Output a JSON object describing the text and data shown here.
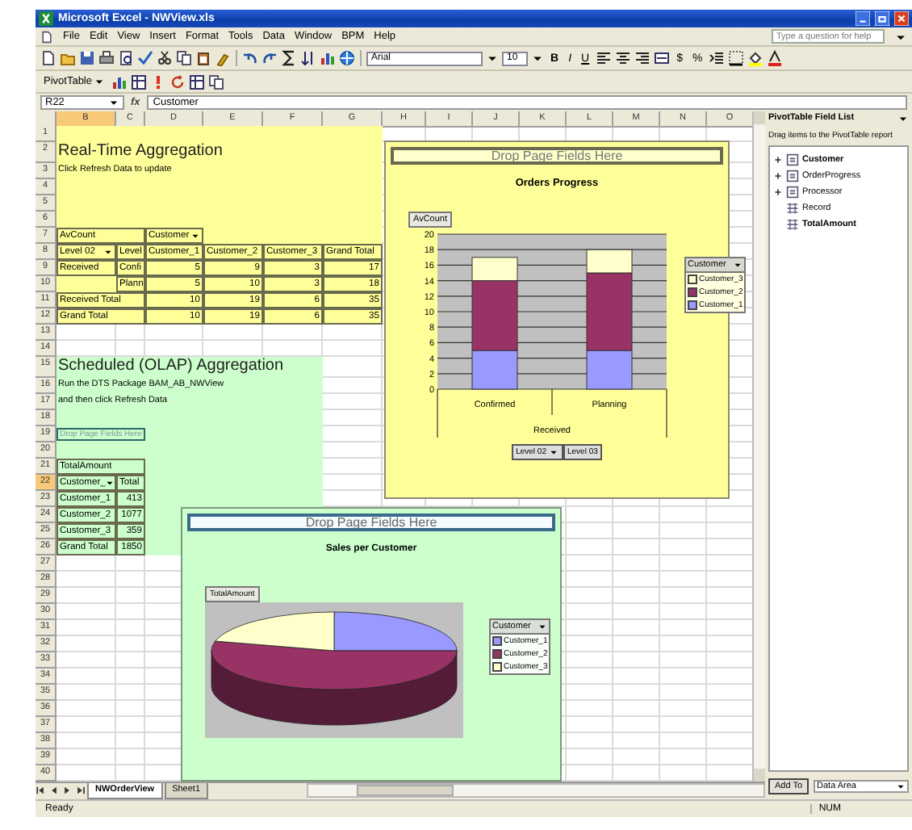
{
  "window": {
    "title": "Microsoft Excel - NWView.xls"
  },
  "menu_bar": {
    "items": [
      "File",
      "Edit",
      "View",
      "Insert",
      "Format",
      "Tools",
      "Data",
      "Window",
      "BPM",
      "Help"
    ],
    "help_box": {
      "placeholder": "Type a question for help"
    }
  },
  "formatting": {
    "font": "Arial",
    "size": "10",
    "styles": [
      "B",
      "I",
      "U"
    ],
    "number_formats": [
      "$",
      "%"
    ]
  },
  "pivot_toolbar": {
    "menu": "PivotTable"
  },
  "formula_bar": {
    "name_box": "R22",
    "function_label": "fx",
    "content": "Customer"
  },
  "sheet": {
    "columns": [
      {
        "label": "B",
        "selected": true
      },
      {
        "label": "C",
        "selected": false
      },
      {
        "label": "D",
        "selected": false
      },
      {
        "label": "E",
        "selected": false
      },
      {
        "label": "F",
        "selected": false
      },
      {
        "label": "G",
        "selected": false
      },
      {
        "label": "H",
        "selected": false
      },
      {
        "label": "I",
        "selected": false
      },
      {
        "label": "J",
        "selected": false
      },
      {
        "label": "K",
        "selected": false
      },
      {
        "label": "L",
        "selected": false
      },
      {
        "label": "M",
        "selected": false
      },
      {
        "label": "N",
        "selected": false
      },
      {
        "label": "O",
        "selected": false
      }
    ],
    "blocks": [
      {
        "kind": "realtime",
        "color": "#ffff99",
        "rows": [
          {
            "number": "1",
            "selected": false,
            "cells": {}
          },
          {
            "number": "2",
            "selected": false,
            "cells": {
              "B": {
                "kind": "title",
                "text": "Real-Time Aggregation"
              }
            }
          },
          {
            "number": "3",
            "selected": false,
            "cells": {
              "B": {
                "kind": "note",
                "text": "Click Refresh Data to update"
              }
            }
          },
          {
            "number": "4",
            "selected": false,
            "cells": {}
          },
          {
            "number": "5",
            "selected": false,
            "cells": {}
          },
          {
            "number": "6",
            "selected": false,
            "cells": {}
          },
          {
            "number": "7",
            "selected": false,
            "cells": {
              "B": {
                "kind": "field",
                "text": "AvCount"
              },
              "D": {
                "kind": "dropdown",
                "text": "Customer"
              }
            }
          },
          {
            "number": "8",
            "selected": false,
            "cells": {
              "B": {
                "kind": "dropdown",
                "text": "Level 02"
              },
              "C": {
                "kind": "field",
                "text": "Level"
              },
              "D": {
                "kind": "field",
                "text": "Customer_1"
              },
              "E": {
                "kind": "field",
                "text": "Customer_2"
              },
              "F": {
                "kind": "field",
                "text": "Customer_3"
              },
              "G": {
                "kind": "field",
                "text": "Grand Total"
              }
            }
          },
          {
            "number": "9",
            "selected": false,
            "cells": {
              "B": {
                "kind": "field",
                "text": "Received"
              },
              "C": {
                "kind": "field",
                "text": "Confi"
              },
              "D": {
                "kind": "number",
                "text": "5"
              },
              "E": {
                "kind": "number",
                "text": "9"
              },
              "F": {
                "kind": "number",
                "text": "3"
              },
              "G": {
                "kind": "number",
                "text": "17"
              }
            }
          },
          {
            "number": "10",
            "selected": false,
            "cells": {
              "C": {
                "kind": "field",
                "text": "Plann"
              },
              "D": {
                "kind": "number",
                "text": "5"
              },
              "E": {
                "kind": "number",
                "text": "10"
              },
              "F": {
                "kind": "number",
                "text": "3"
              },
              "G": {
                "kind": "number",
                "text": "18"
              }
            }
          },
          {
            "number": "11",
            "selected": false,
            "cells": {
              "B": {
                "kind": "field",
                "text": "Received Total"
              },
              "D": {
                "kind": "number",
                "text": "10"
              },
              "E": {
                "kind": "number",
                "text": "19"
              },
              "F": {
                "kind": "number",
                "text": "6"
              },
              "G": {
                "kind": "number",
                "text": "35"
              }
            }
          },
          {
            "number": "12",
            "selected": false,
            "cells": {
              "B": {
                "kind": "field",
                "text": "Grand Total"
              },
              "D": {
                "kind": "number",
                "text": "10"
              },
              "E": {
                "kind": "number",
                "text": "19"
              },
              "F": {
                "kind": "number",
                "text": "6"
              },
              "G": {
                "kind": "number",
                "text": "35"
              }
            }
          }
        ]
      },
      {
        "rows": [
          {
            "number": "13",
            "selected": false,
            "cells": {}
          },
          {
            "number": "14",
            "selected": false,
            "cells": {}
          }
        ]
      },
      {
        "kind": "scheduled",
        "color": "#ccffcc",
        "rows": [
          {
            "number": "15",
            "selected": false,
            "cells": {
              "B": {
                "kind": "title",
                "text": "Scheduled (OLAP) Aggregation"
              }
            }
          },
          {
            "number": "16",
            "selected": false,
            "cells": {
              "B": {
                "kind": "note",
                "text": "Run the DTS Package BAM_AB_NWView"
              }
            }
          },
          {
            "number": "17",
            "selected": false,
            "cells": {
              "B": {
                "kind": "note",
                "text": "and then click Refresh Data"
              }
            }
          },
          {
            "number": "18",
            "selected": false,
            "cells": {}
          },
          {
            "number": "19",
            "selected": false,
            "cells": {
              "B": {
                "kind": "button",
                "text": "Drop Page Fields Here"
              }
            }
          },
          {
            "number": "20",
            "selected": false,
            "cells": {}
          },
          {
            "number": "21",
            "selected": false,
            "cells": {
              "B": {
                "kind": "field",
                "text": "TotalAmount"
              }
            }
          },
          {
            "number": "22",
            "selected": true,
            "cells": {
              "B": {
                "kind": "dropdown",
                "text": "Customer_"
              },
              "C": {
                "kind": "field",
                "text": "Total"
              }
            }
          },
          {
            "number": "23",
            "selected": false,
            "cells": {
              "B": {
                "kind": "field",
                "text": "Customer_1"
              },
              "C": {
                "kind": "number",
                "text": "413"
              }
            }
          },
          {
            "number": "24",
            "selected": false,
            "cells": {
              "B": {
                "kind": "field",
                "text": "Customer_2"
              },
              "C": {
                "kind": "number",
                "text": "1077"
              }
            }
          },
          {
            "number": "25",
            "selected": false,
            "cells": {
              "B": {
                "kind": "field",
                "text": "Customer_3"
              },
              "C": {
                "kind": "number",
                "text": "359"
              }
            }
          },
          {
            "number": "26",
            "selected": false,
            "cells": {
              "B": {
                "kind": "field",
                "text": "Grand Total"
              },
              "C": {
                "kind": "number",
                "text": "1850"
              }
            }
          }
        ]
      },
      {
        "rows": [
          {
            "number": "27",
            "selected": false,
            "cells": {}
          },
          {
            "number": "28",
            "selected": false,
            "cells": {}
          },
          {
            "number": "29",
            "selected": false,
            "cells": {}
          },
          {
            "number": "30",
            "selected": false,
            "cells": {}
          },
          {
            "number": "31",
            "selected": false,
            "cells": {}
          },
          {
            "number": "32",
            "selected": false,
            "cells": {}
          },
          {
            "number": "33",
            "selected": false,
            "cells": {}
          },
          {
            "number": "34",
            "selected": false,
            "cells": {}
          },
          {
            "number": "35",
            "selected": false,
            "cells": {}
          },
          {
            "number": "36",
            "selected": false,
            "cells": {}
          },
          {
            "number": "37",
            "selected": false,
            "cells": {}
          },
          {
            "number": "38",
            "selected": false,
            "cells": {}
          },
          {
            "number": "39",
            "selected": false,
            "cells": {}
          },
          {
            "number": "40",
            "selected": false,
            "cells": {}
          }
        ]
      }
    ]
  },
  "charts": [
    {
      "kind": "bar",
      "page_area": "Drop Page Fields Here",
      "data_field": "AvCount",
      "legend_title": "Customer",
      "row_fields": [
        "Level 02",
        "Level 03"
      ],
      "chart_data": {
        "type": "bar",
        "title": "Orders Progress",
        "xlabel": "Received",
        "categories": [
          "Confirmed",
          "Planning"
        ],
        "stacked": true,
        "grid": true,
        "ylim": [
          0,
          20
        ],
        "yticks": [
          {
            "value": 0,
            "label": "0"
          },
          {
            "value": 2,
            "label": "2"
          },
          {
            "value": 4,
            "label": "4"
          },
          {
            "value": 6,
            "label": "6"
          },
          {
            "value": 8,
            "label": "8"
          },
          {
            "value": 10,
            "label": "10"
          },
          {
            "value": 12,
            "label": "12"
          },
          {
            "value": 14,
            "label": "14"
          },
          {
            "value": 16,
            "label": "16"
          },
          {
            "value": 18,
            "label": "18"
          },
          {
            "value": 20,
            "label": "20"
          }
        ],
        "series": [
          {
            "name": "Customer_1",
            "color": "#9999ff",
            "values": [
              5,
              5
            ]
          },
          {
            "name": "Customer_2",
            "color": "#993366",
            "values": [
              9,
              10
            ]
          },
          {
            "name": "Customer_3",
            "color": "#ffffcc",
            "values": [
              3,
              3
            ]
          }
        ]
      }
    },
    {
      "kind": "pie",
      "page_area": "Drop Page Fields Here",
      "title": "Sales per Customer",
      "data_field": "TotalAmount",
      "legend_title": "Customer",
      "legend": [
        {
          "name": "Customer_1",
          "color": "#9999ff"
        },
        {
          "name": "Customer_2",
          "color": "#993366"
        },
        {
          "name": "Customer_3",
          "color": "#ffffcc"
        }
      ]
    }
  ],
  "field_list": {
    "title": "PivotTable Field List",
    "hint": "Drag items to the PivotTable report",
    "fields": [
      {
        "name": "Customer",
        "kind": "dimension",
        "expanded": false,
        "in_report": true
      },
      {
        "name": "OrderProgress",
        "kind": "dimension",
        "expanded": false,
        "in_report": false
      },
      {
        "name": "Processor",
        "kind": "dimension",
        "expanded": false,
        "in_report": false
      },
      {
        "name": "Record",
        "kind": "measure",
        "in_report": false
      },
      {
        "name": "TotalAmount",
        "kind": "measure",
        "in_report": true
      }
    ],
    "add_button": "Add To",
    "area": "Data Area"
  },
  "sheet_tabs": [
    {
      "label": "NWOrderView",
      "selected": true
    },
    {
      "label": "Sheet1",
      "selected": false
    }
  ],
  "status_bar": {
    "mode": "Ready",
    "indicator": "NUM"
  }
}
